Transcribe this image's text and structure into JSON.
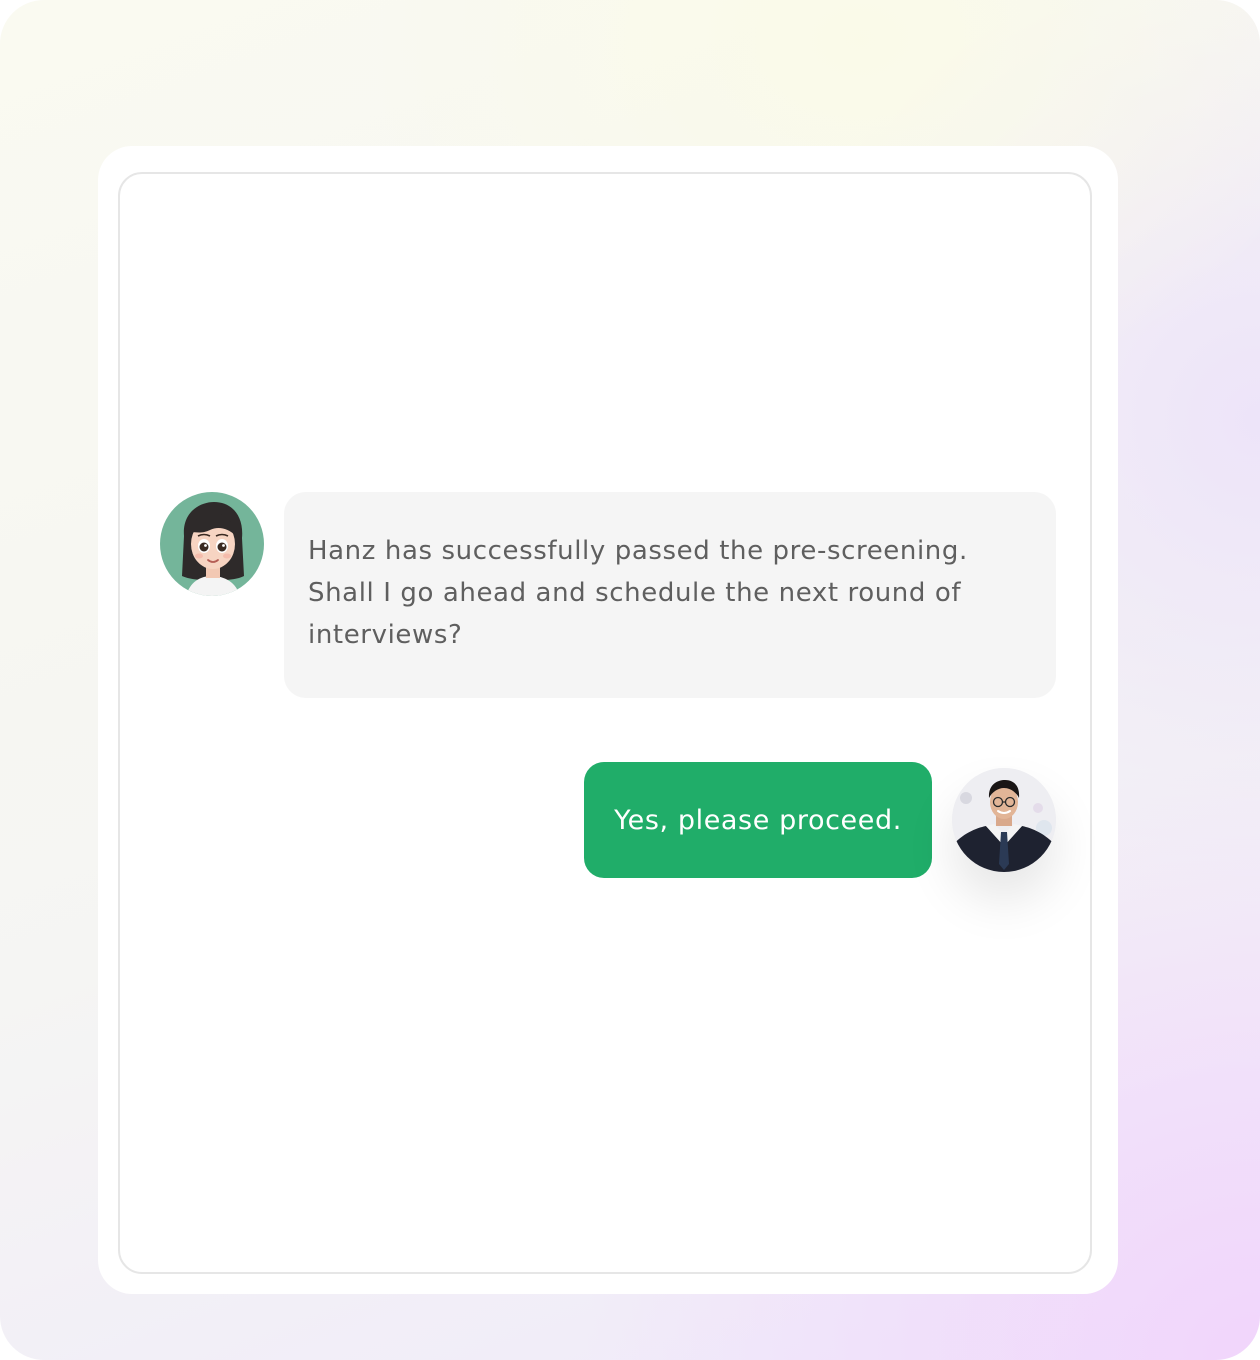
{
  "colors": {
    "assistant_bubble_bg": "#f5f5f5",
    "assistant_text": "#5f5f5f",
    "user_bubble_bg": "#20ad69",
    "user_text": "#ffffff",
    "assistant_avatar_bg": "#74b59a"
  },
  "chat": {
    "messages": [
      {
        "sender": "assistant",
        "avatar_icon": "cartoon-woman-avatar",
        "text": "Hanz has successfully passed the pre-screening. Shall I go ahead and schedule the next round of interviews?"
      },
      {
        "sender": "user",
        "avatar_icon": "businessman-photo-avatar",
        "text": "Yes, please proceed."
      }
    ]
  }
}
